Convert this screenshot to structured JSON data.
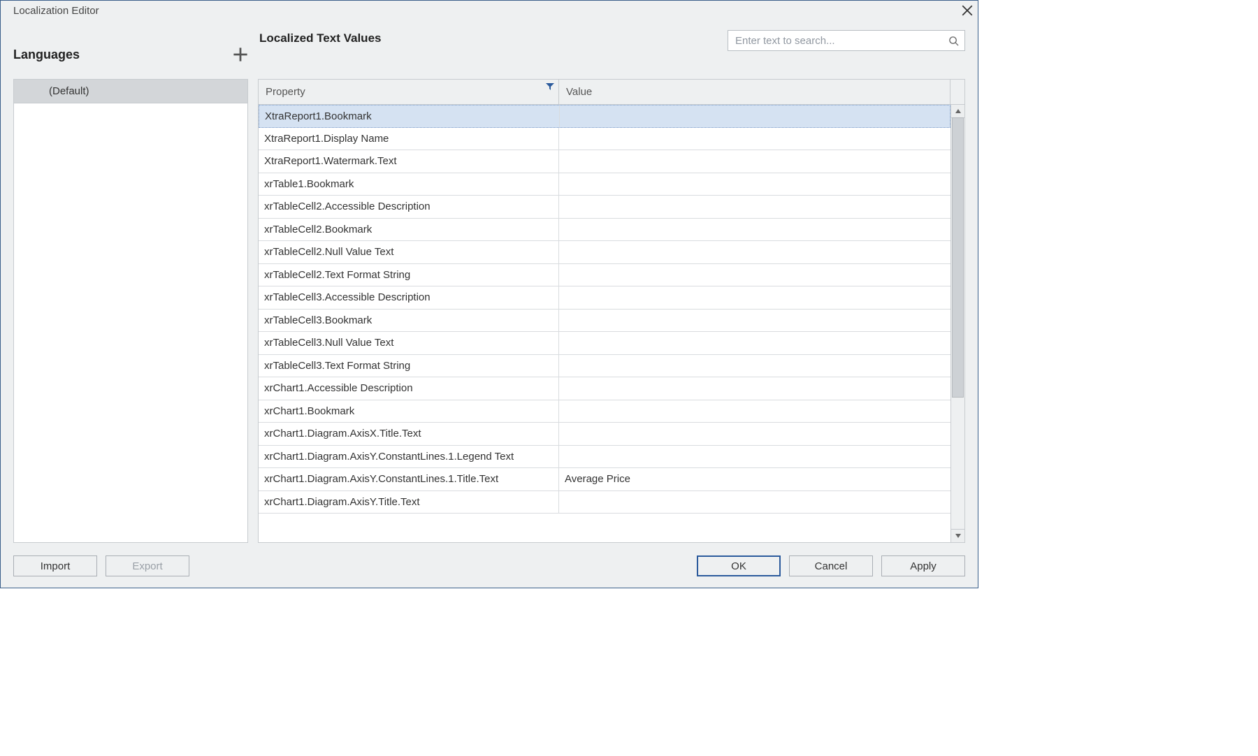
{
  "window": {
    "title": "Localization Editor"
  },
  "languages": {
    "heading": "Languages",
    "items": [
      "(Default)"
    ]
  },
  "main": {
    "heading": "Localized Text Values",
    "search_placeholder": "Enter text to search...",
    "columns": {
      "property": "Property",
      "value": "Value"
    },
    "rows": [
      {
        "property": "XtraReport1.Bookmark",
        "value": ""
      },
      {
        "property": "XtraReport1.Display Name",
        "value": ""
      },
      {
        "property": "XtraReport1.Watermark.Text",
        "value": ""
      },
      {
        "property": "xrTable1.Bookmark",
        "value": ""
      },
      {
        "property": "xrTableCell2.Accessible Description",
        "value": ""
      },
      {
        "property": "xrTableCell2.Bookmark",
        "value": ""
      },
      {
        "property": "xrTableCell2.Null Value Text",
        "value": ""
      },
      {
        "property": "xrTableCell2.Text Format String",
        "value": ""
      },
      {
        "property": "xrTableCell3.Accessible Description",
        "value": ""
      },
      {
        "property": "xrTableCell3.Bookmark",
        "value": ""
      },
      {
        "property": "xrTableCell3.Null Value Text",
        "value": ""
      },
      {
        "property": "xrTableCell3.Text Format String",
        "value": ""
      },
      {
        "property": "xrChart1.Accessible Description",
        "value": ""
      },
      {
        "property": "xrChart1.Bookmark",
        "value": ""
      },
      {
        "property": "xrChart1.Diagram.AxisX.Title.Text",
        "value": ""
      },
      {
        "property": "xrChart1.Diagram.AxisY.ConstantLines.1.Legend Text",
        "value": ""
      },
      {
        "property": "xrChart1.Diagram.AxisY.ConstantLines.1.Title.Text",
        "value": "Average Price"
      },
      {
        "property": "xrChart1.Diagram.AxisY.Title.Text",
        "value": ""
      }
    ],
    "selected_row_index": 0
  },
  "footer": {
    "import": "Import",
    "export": "Export",
    "ok": "OK",
    "cancel": "Cancel",
    "apply": "Apply"
  }
}
